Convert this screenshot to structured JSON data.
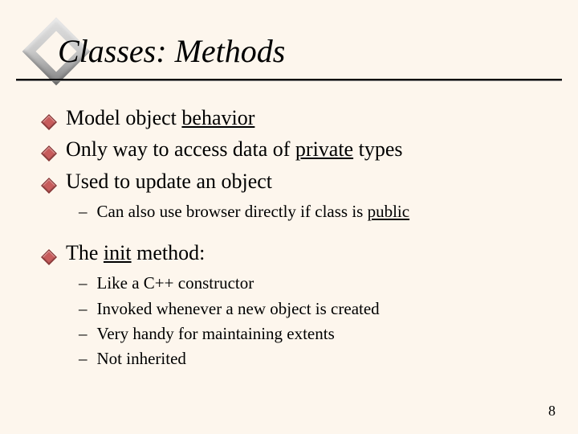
{
  "title": "Classes:  Methods",
  "bullets": [
    {
      "pre": "Model object ",
      "u": "behavior",
      "post": ""
    },
    {
      "pre": "Only way to access data of ",
      "u": "private",
      "post": " types"
    },
    {
      "pre": "Used to update an object",
      "u": "",
      "post": ""
    }
  ],
  "sub_after_3": [
    {
      "pre": "Can also use browser directly if class is ",
      "u": "public",
      "post": ""
    }
  ],
  "bullet4": {
    "pre": "The ",
    "u": "init",
    "post": " method:"
  },
  "sub_after_4": [
    {
      "pre": "Like a C++ constructor",
      "u": "",
      "post": ""
    },
    {
      "pre": "Invoked whenever a new object is created",
      "u": "",
      "post": ""
    },
    {
      "pre": "Very handy for maintaining extents",
      "u": "",
      "post": ""
    },
    {
      "pre": "Not inherited",
      "u": "",
      "post": ""
    }
  ],
  "dash": "–",
  "page_number": "8"
}
